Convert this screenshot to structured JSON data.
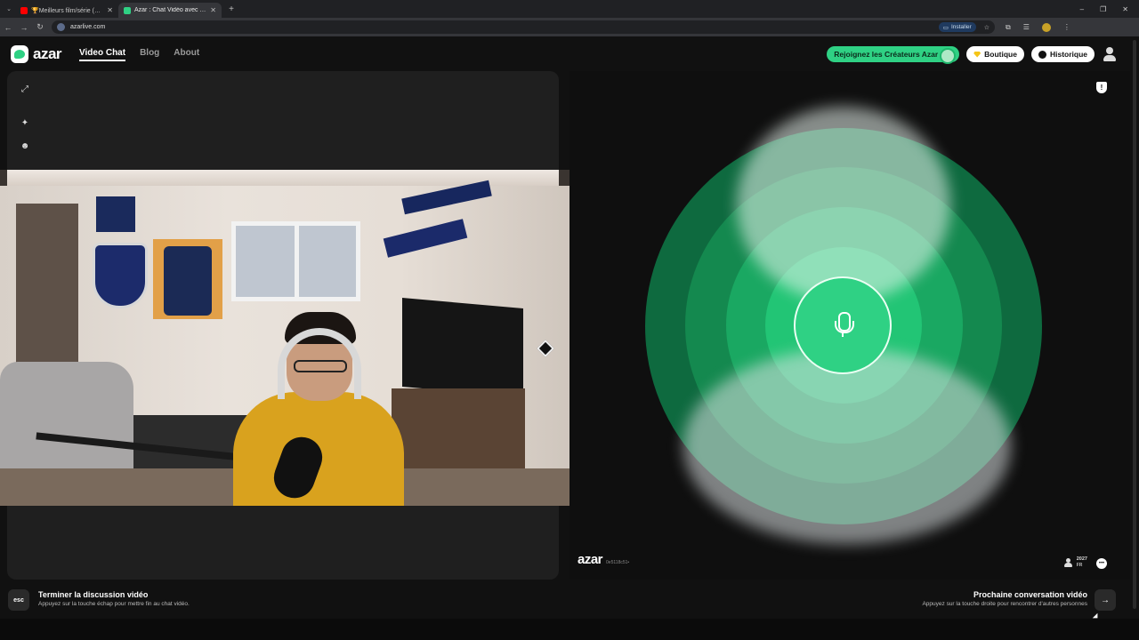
{
  "browser": {
    "tabs": [
      {
        "title": "🏆Meilleurs film/série (extrait ...",
        "active": false,
        "favicon_color": "#ff0000"
      },
      {
        "title": "Azar : Chat Vidéo avec de ...",
        "active": true,
        "favicon_color": "#2fd184"
      }
    ],
    "new_tab_glyph": "+",
    "url": "azarlive.com",
    "install_label": "Installer",
    "window_controls": {
      "minimize": "–",
      "restore": "❐",
      "close": "✕"
    }
  },
  "header": {
    "logo_text": "azar",
    "nav": [
      {
        "label": "Video Chat",
        "active": true
      },
      {
        "label": "Blog",
        "active": false
      },
      {
        "label": "About",
        "active": false
      }
    ],
    "creators_label": "Rejoignez les Créateurs Azar",
    "shop_label": "Boutique",
    "history_label": "Historique"
  },
  "left_panel": {
    "tools": [
      "expand-icon",
      "effects-sparkle-icon",
      "face-filter-icon"
    ]
  },
  "right_panel": {
    "status": "waiting-for-match",
    "watermark_logo": "azar",
    "watermark_id": "0e5118c51•",
    "online_count": "2027",
    "online_region": "FR",
    "colors": {
      "accent": "#2fd184",
      "ring_dark": "#0e6a3f"
    }
  },
  "bottom": {
    "esc_key": "esc",
    "end_title": "Terminer la discussion vidéo",
    "end_subtitle": "Appuyez sur la touche échap pour mettre fin au chat vidéo.",
    "next_title": "Prochaine conversation vidéo",
    "next_subtitle": "Appuyez sur la touche droite pour rencontrer d'autres personnes",
    "next_key_glyph": "→"
  }
}
